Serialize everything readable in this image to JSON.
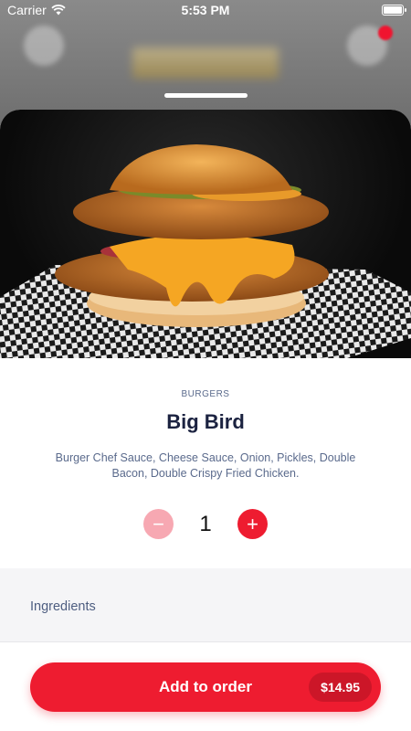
{
  "status_bar": {
    "carrier": "Carrier",
    "time": "5:53 PM"
  },
  "product": {
    "category": "BURGERS",
    "name": "Big Bird",
    "description": "Burger Chef Sauce, Cheese Sauce, Onion, Pickles, Double Bacon, Double Crispy Fried Chicken."
  },
  "quantity": {
    "value": "1",
    "minus_icon": "minus-icon",
    "plus_icon": "plus-icon"
  },
  "sections": {
    "ingredients_label": "Ingredients"
  },
  "footer": {
    "button_label": "Add to order",
    "price": "$14.95"
  },
  "colors": {
    "accent": "#ee1c30",
    "accent_light": "#f7a8b2",
    "text_primary": "#1b2240",
    "text_secondary": "#5a6a8c"
  }
}
